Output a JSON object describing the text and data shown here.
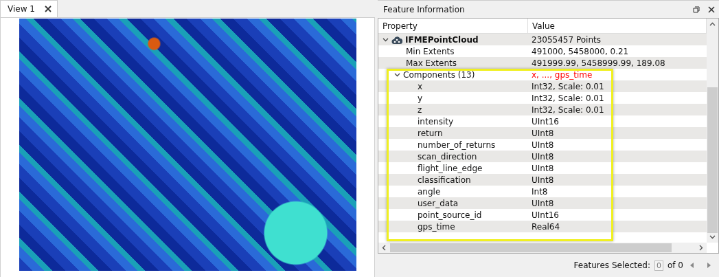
{
  "view_tabs": [
    {
      "label": "View 1",
      "selected": true
    }
  ],
  "panel": {
    "title": "Feature Information"
  },
  "table": {
    "columns": [
      "Property",
      "Value"
    ],
    "rows": [
      {
        "property": "IFMEPointCloud",
        "value": "23055457 Points",
        "kind": "feature",
        "expanded": true,
        "children": [
          {
            "property": "Min Extents",
            "value": "491000, 5458000, 0.21"
          },
          {
            "property": "Max Extents",
            "value": "491999.99, 5458999.99, 189.08"
          },
          {
            "property": "Components (13)",
            "value": "x, ..., gps_time",
            "color": "#ff0000",
            "expanded": true,
            "highlighted": true,
            "children": [
              {
                "property": "x",
                "value": "Int32, Scale: 0.01"
              },
              {
                "property": "y",
                "value": "Int32, Scale: 0.01"
              },
              {
                "property": "z",
                "value": "Int32, Scale: 0.01"
              },
              {
                "property": "intensity",
                "value": "UInt16"
              },
              {
                "property": "return",
                "value": "UInt8"
              },
              {
                "property": "number_of_returns",
                "value": "UInt8"
              },
              {
                "property": "scan_direction",
                "value": "UInt8"
              },
              {
                "property": "flight_line_edge",
                "value": "UInt8"
              },
              {
                "property": "classification",
                "value": "UInt8"
              },
              {
                "property": "angle",
                "value": "Int8"
              },
              {
                "property": "user_data",
                "value": "UInt8"
              },
              {
                "property": "point_source_id",
                "value": "UInt16"
              },
              {
                "property": "gps_time",
                "value": "Real64"
              }
            ]
          }
        ]
      }
    ]
  },
  "status_bar": {
    "label": "Features Selected:",
    "current": "0",
    "total": "of 0"
  }
}
